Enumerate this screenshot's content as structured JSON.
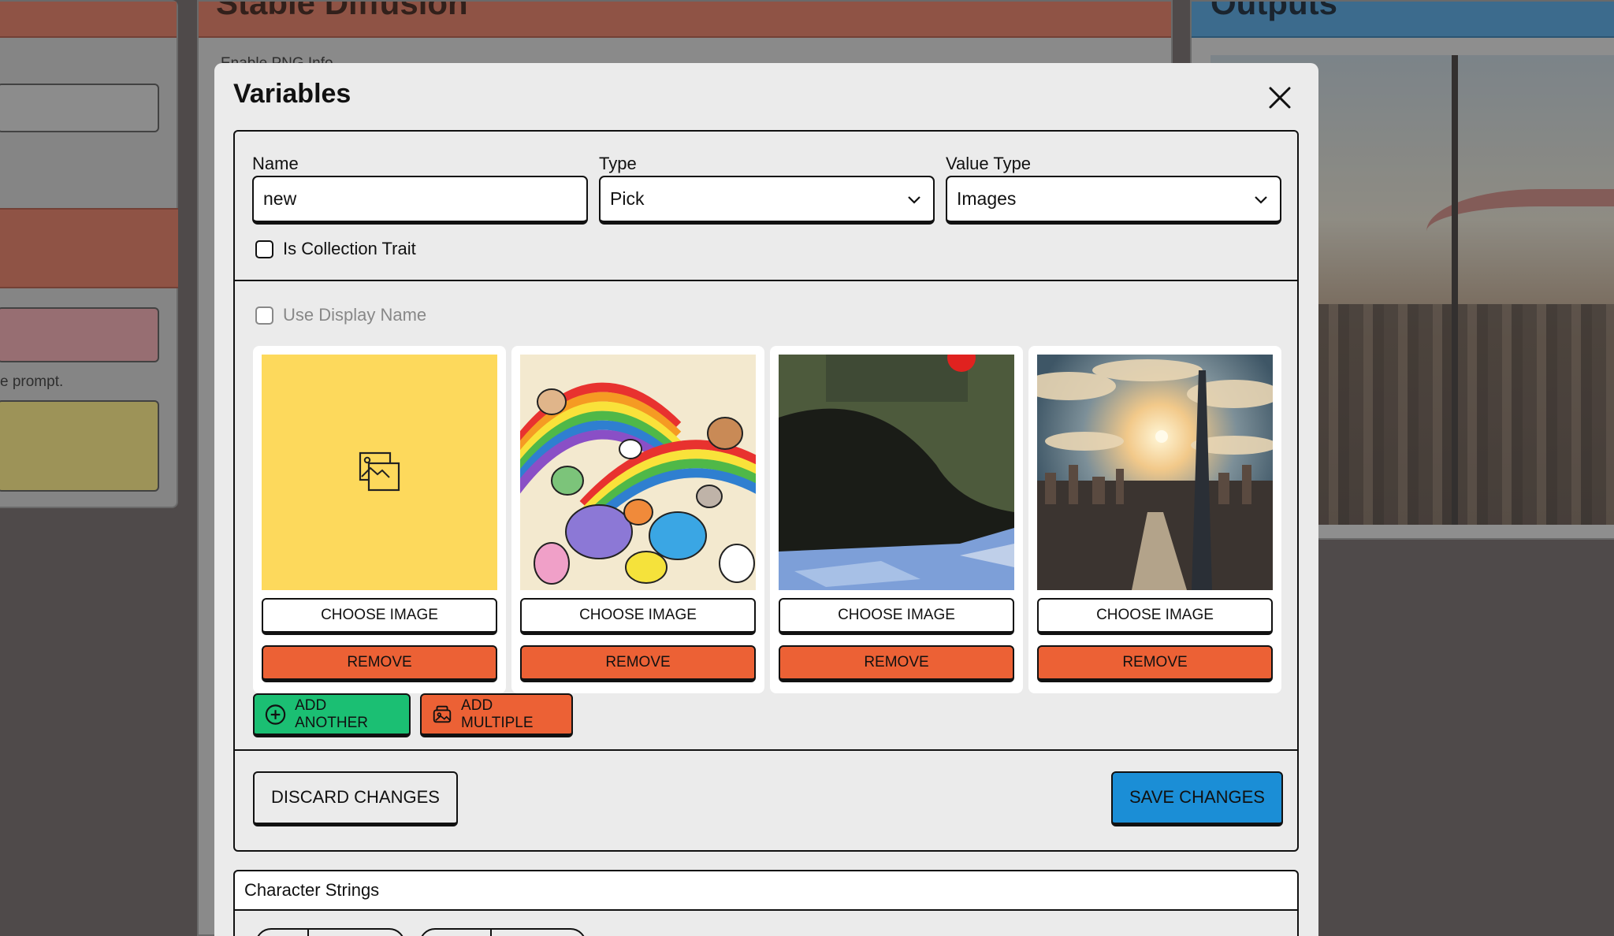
{
  "background": {
    "middle_title": "Stable Diffusion",
    "middle_option": "Enable PNG Info",
    "right_title": "Outputs",
    "left_hint": "e prompt."
  },
  "modal": {
    "title": "Variables",
    "close_icon": "close-icon",
    "fields": {
      "name_label": "Name",
      "name_value": "new",
      "type_label": "Type",
      "type_value": "Pick",
      "value_type_label": "Value Type",
      "value_type_value": "Images",
      "is_collection_trait": "Is Collection Trait",
      "use_display_name": "Use Display Name"
    },
    "images": [
      {
        "kind": "placeholder",
        "icon": "image-placeholder-icon",
        "choose_label": "CHOOSE IMAGE",
        "remove_label": "REMOVE"
      },
      {
        "kind": "rainbow-animals",
        "choose_label": "CHOOSE IMAGE",
        "remove_label": "REMOVE"
      },
      {
        "kind": "abstract-painting",
        "choose_label": "CHOOSE IMAGE",
        "remove_label": "REMOVE"
      },
      {
        "kind": "city-skyline",
        "choose_label": "CHOOSE IMAGE",
        "remove_label": "REMOVE"
      }
    ],
    "add_another_label": "ADD ANOTHER",
    "add_multiple_label": "ADD MULTIPLE",
    "discard_label": "DISCARD CHANGES",
    "save_label": "SAVE CHANGES",
    "next_section_title": "Character Strings"
  },
  "colors": {
    "remove": "#ec6135",
    "add_another": "#1bbf73",
    "save": "#1b8ed6",
    "placeholder": "#fdd95c"
  }
}
